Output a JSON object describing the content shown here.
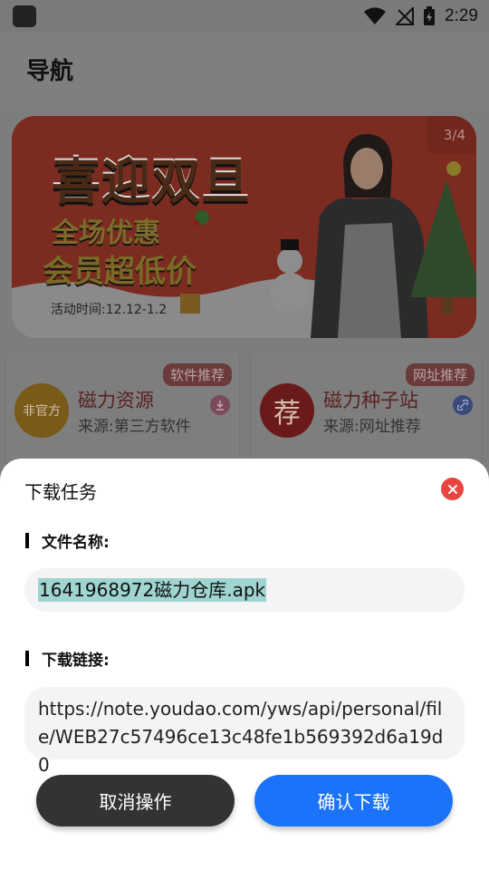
{
  "status_bar": {
    "time": "2:29"
  },
  "header": {
    "title": "导航"
  },
  "banner": {
    "counter": "3/4",
    "headline": "喜迎双旦",
    "sub1": "全场优惠",
    "sub2": "会员超低价",
    "event_time": "活动时间:12.12-1.2"
  },
  "cards": [
    {
      "tag": "软件推荐",
      "avatar_text": "非官方",
      "title": "磁力资源",
      "desc": "来源:第三方软件",
      "action_icon": "download-icon"
    },
    {
      "tag": "网址推荐",
      "avatar_text": "荐",
      "title": "磁力种子站",
      "desc": "来源:网址推荐",
      "action_icon": "link-icon"
    }
  ],
  "dialog": {
    "title": "下载任务",
    "file_name_label": "文件名称:",
    "file_name_value": "1641968972磁力仓库.apk",
    "link_label": "下载链接:",
    "link_value": "https://note.youdao.com/yws/api/personal/file/WEB27c57496ce13c48fe1b569392d6a19d0",
    "cancel_label": "取消操作",
    "confirm_label": "确认下载"
  },
  "colors": {
    "confirm": "#1a73f8",
    "cancel": "#333333",
    "close": "#e9443f",
    "highlight": "#9fd4d0"
  }
}
